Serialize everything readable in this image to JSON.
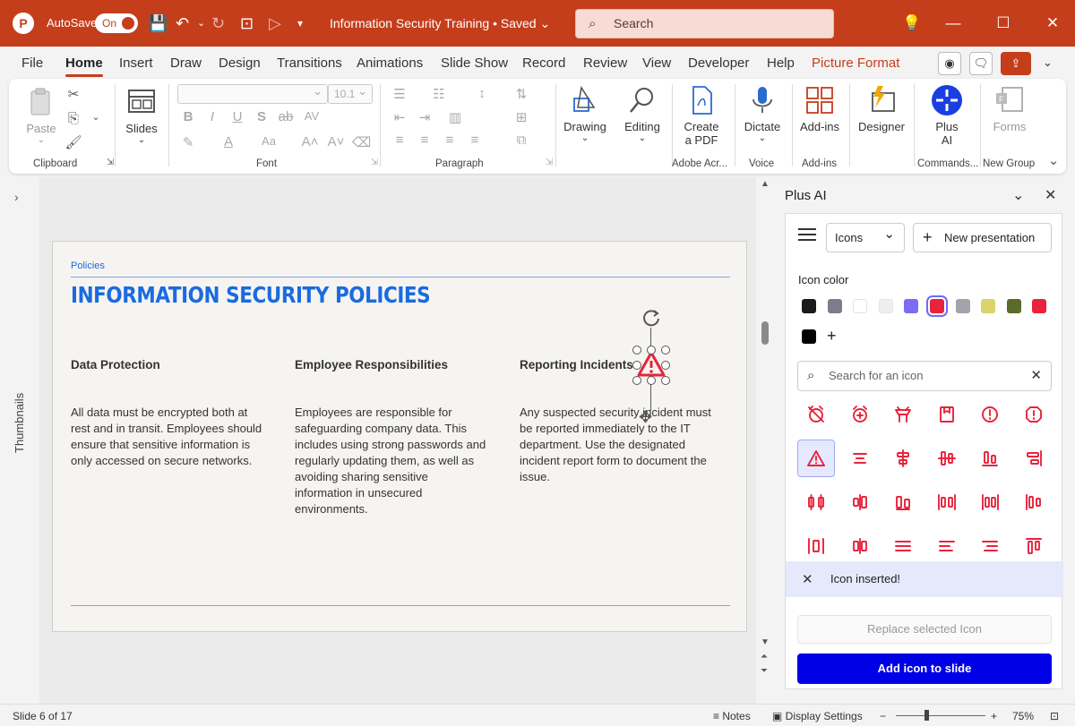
{
  "titlebar": {
    "logo": "P",
    "autosave_label": "AutoSave",
    "autosave_state": "On",
    "doc_title": "Information Security Training • Saved",
    "search_placeholder": "Search"
  },
  "menu": {
    "tabs": [
      "File",
      "Home",
      "Insert",
      "Draw",
      "Design",
      "Transitions",
      "Animations",
      "Slide Show",
      "Record",
      "Review",
      "View",
      "Developer",
      "Help",
      "Picture Format"
    ],
    "active": "Home"
  },
  "ribbon": {
    "clipboard": {
      "paste": "Paste",
      "label": "Clipboard"
    },
    "slides": {
      "label_btn": "Slides"
    },
    "font": {
      "size": "10.1",
      "label": "Font"
    },
    "paragraph": {
      "label": "Paragraph"
    },
    "drawing": "Drawing",
    "editing": "Editing",
    "create_pdf_1": "Create",
    "create_pdf_2": "a PDF",
    "adobe_label": "Adobe Acr...",
    "dictate": "Dictate",
    "voice_label": "Voice",
    "addins": "Add-ins",
    "addins_label": "Add-ins",
    "designer": "Designer",
    "plusai_1": "Plus",
    "plusai_2": "AI",
    "commands_label": "Commands...",
    "forms": "Forms",
    "newgroup_label": "New Group"
  },
  "thumbnails": {
    "label": "Thumbnails"
  },
  "slide": {
    "crumb": "Policies",
    "heading": "INFORMATION SECURITY POLICIES",
    "columns": [
      {
        "heading": "Data Protection",
        "body": "All data must be encrypted both at rest and in transit. Employees should ensure that sensitive information is only accessed on secure networks."
      },
      {
        "heading": "Employee Responsibilities",
        "body": "Employees are responsible for safeguarding company data. This includes using strong passwords and regularly updating them, as well as avoiding sharing sensitive information in unsecured environments."
      },
      {
        "heading": "Reporting Incidents",
        "body": "Any suspected security incident must be reported immediately to the IT department. Use the designated incident report form to document the issue."
      }
    ]
  },
  "panel": {
    "title": "Plus AI",
    "mode": "Icons",
    "new_presentation": "New presentation",
    "icon_color_label": "Icon color",
    "swatches": [
      "#1a1a1a",
      "#7c7c8c",
      "#ffffff",
      "#eeeeee",
      "#7b6cf0",
      "#e8233c",
      "#a3a3ab",
      "#d9d56a",
      "#5a6b2b",
      "#e8233c",
      "#000000"
    ],
    "selected_swatch": 5,
    "icon_color": "#e8233c",
    "search_placeholder": "Search for an icon",
    "icons": [
      "alarm-off-icon",
      "alarm-plus-icon",
      "alarm-lamp-icon",
      "bookmark-save-icon",
      "alert-circle-icon",
      "alert-octagon-icon",
      "alert-triangle-icon",
      "align-center-icon",
      "align-center-horizontal-icon",
      "align-center-vertical-icon",
      "align-end-horizontal-icon",
      "align-end-vertical-icon",
      "distribute-center-icon",
      "distribute-horizontal-center-icon",
      "distribute-end-icon",
      "distribute-horizontal-icon",
      "distribute-space-icon",
      "distribute-start-icon",
      "distribute-vertical-icon",
      "align-horizontal-distribute-icon",
      "align-justify-icon",
      "align-left-icon",
      "align-right-icon",
      "align-start-vertical-icon"
    ],
    "toast": "Icon inserted!",
    "replace_btn": "Replace selected Icon",
    "add_btn": "Add icon to slide"
  },
  "status": {
    "slide_info": "Slide 6 of 17",
    "notes": "Notes",
    "display_settings": "Display Settings",
    "zoom": "75%"
  }
}
